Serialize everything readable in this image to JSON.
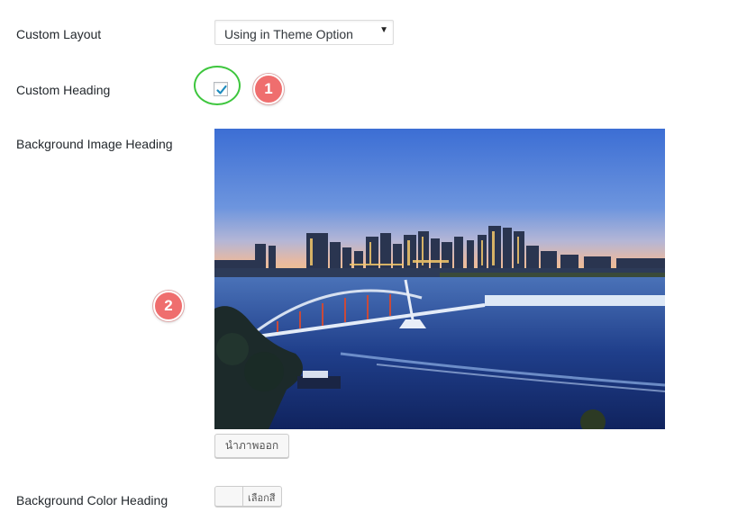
{
  "form": {
    "custom_layout": {
      "label": "Custom Layout",
      "selected": "Using in Theme Option"
    },
    "custom_heading": {
      "label": "Custom Heading",
      "checked": true
    },
    "background_image": {
      "label": "Background Image Heading",
      "remove_button": "นำภาพออก"
    },
    "background_color": {
      "label": "Background Color Heading",
      "button_label": "เลือกสี"
    }
  },
  "annotations": {
    "badge_1": "1",
    "badge_2": "2",
    "badge_color": "#ef6e6e",
    "highlight_color": "#3ec63e"
  },
  "colors": {
    "text": "#23282d",
    "checkmark": "#1e8cbe"
  },
  "icons": {
    "checkbox": "checkmark-icon",
    "select": "triangle-down-icon"
  }
}
